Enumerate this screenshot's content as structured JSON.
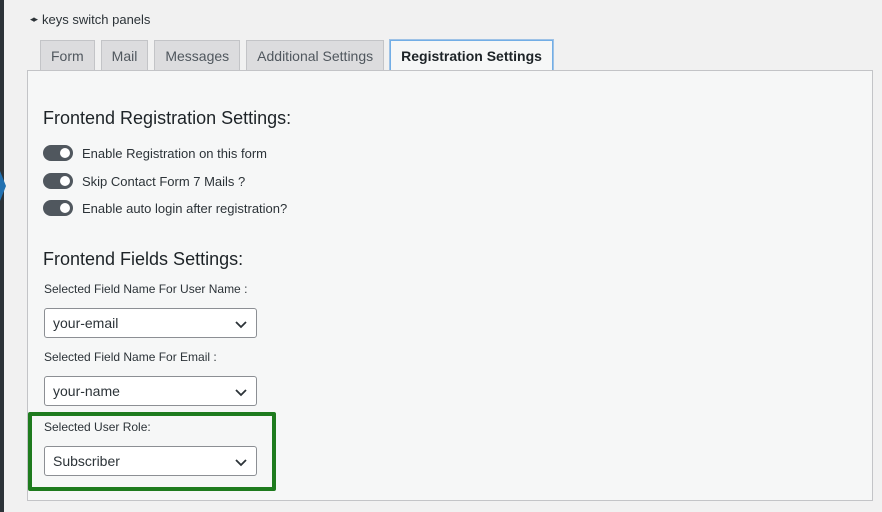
{
  "keys_hint": {
    "arrows": "◂▸",
    "label": "keys switch panels"
  },
  "tabs": [
    {
      "label": "Form",
      "active": false
    },
    {
      "label": "Mail",
      "active": false
    },
    {
      "label": "Messages",
      "active": false
    },
    {
      "label": "Additional Settings",
      "active": false
    },
    {
      "label": "Registration Settings",
      "active": true
    }
  ],
  "registration": {
    "title": "Frontend Registration Settings:",
    "toggles": [
      {
        "label": "Enable Registration on this form",
        "on": true
      },
      {
        "label": "Skip Contact Form 7 Mails ?",
        "on": true
      },
      {
        "label": "Enable auto login after registration?",
        "on": true
      }
    ]
  },
  "fields": {
    "title": "Frontend Fields Settings:",
    "username_label": "Selected Field Name For User Name :",
    "username_value": "your-email",
    "email_label": "Selected Field Name For Email :",
    "email_value": "your-name",
    "role_label": "Selected User Role:",
    "role_value": "Subscriber"
  },
  "colors": {
    "highlight": "#1e7b1e",
    "active_tab_border": "#72aee6"
  }
}
